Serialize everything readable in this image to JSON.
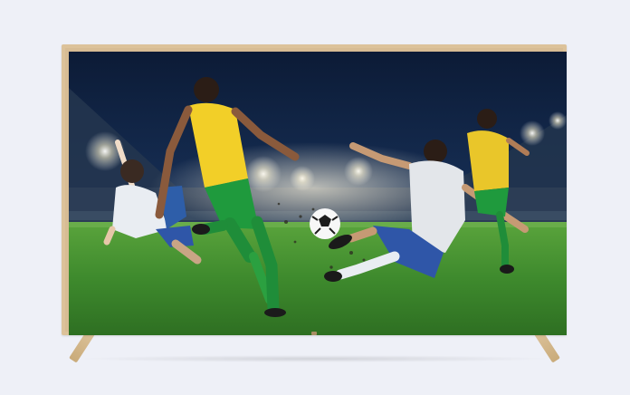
{
  "scene": {
    "subject": "television",
    "screen_content": "football-match",
    "colors": {
      "background": "#eef0f7",
      "tv_frame": "#dcc29a",
      "sky": "#0d1d3a",
      "pitch": "#3e8a2d",
      "yellow_kit": "#f2cf28",
      "green_shorts": "#1f9a3d",
      "white_kit": "#e9edf2",
      "blue_shorts": "#2f56a8"
    }
  }
}
